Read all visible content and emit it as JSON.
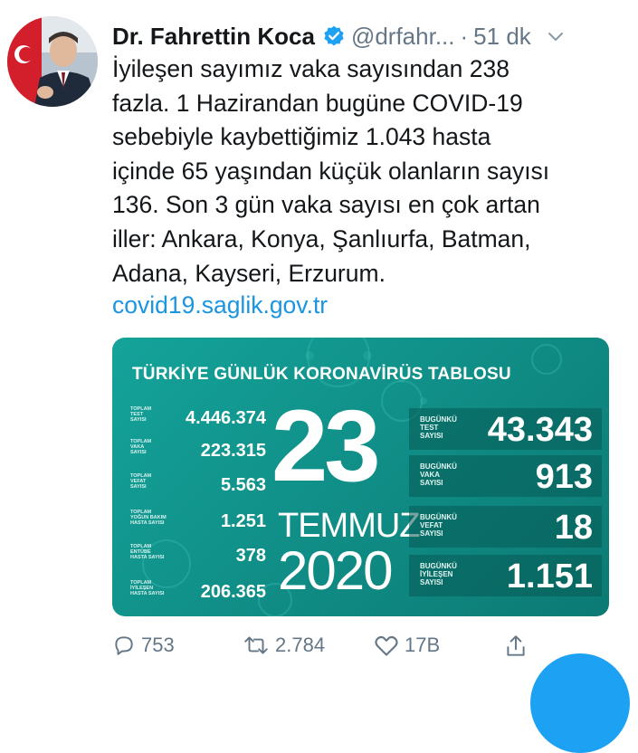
{
  "tweet": {
    "author_name": "Dr. Fahrettin Koca",
    "handle": "@drfahr...",
    "separator": "·",
    "time": "51 dk",
    "verified_icon": "verified-badge-icon",
    "body_lines": [
      "İyileşen sayımız vaka sayısından 238",
      "fazla. 1 Hazirandan bugüne COVID-19",
      "sebebiyle kaybettiğimiz 1.043 hasta",
      "içinde 65 yaşından küçük olanların sayısı",
      "136. Son 3 gün vaka sayısı en çok artan",
      "iller: Ankara, Konya, Şanlıurfa, Batman,",
      "Adana, Kayseri, Erzurum."
    ],
    "link": "covid19.saglik.gov.tr"
  },
  "card": {
    "title": "TÜRKİYE GÜNLÜK KORONAVİRÜS TABLOSU",
    "day": "23",
    "month": "TEMMUZ",
    "year": "2020",
    "background_color": "#14a39a",
    "totals": [
      {
        "label_lines": [
          "TOPLAM",
          "TEST",
          "SAYISI"
        ],
        "value": "4.446.374"
      },
      {
        "label_lines": [
          "TOPLAM",
          "VAKA",
          "SAYISI"
        ],
        "value": "223.315"
      },
      {
        "label_lines": [
          "TOPLAM",
          "VEFAT",
          "SAYISI"
        ],
        "value": "5.563"
      },
      {
        "label_lines": [
          "TOPLAM",
          "YOĞUN BAKIM",
          "HASTA SAYISI"
        ],
        "value": "1.251"
      },
      {
        "label_lines": [
          "TOPLAM",
          "ENTÜBE",
          "HASTA SAYISI"
        ],
        "value": "378"
      },
      {
        "label_lines": [
          "TOPLAM",
          "İYİLEŞEN",
          "HASTA SAYISI"
        ],
        "value": "206.365"
      }
    ],
    "today": [
      {
        "label_lines": [
          "BUGÜNKÜ",
          "TEST",
          "SAYISI"
        ],
        "value": "43.343"
      },
      {
        "label_lines": [
          "BUGÜNKÜ",
          "VAKA",
          "SAYISI"
        ],
        "value": "913"
      },
      {
        "label_lines": [
          "BUGÜNKÜ",
          "VEFAT",
          "SAYISI"
        ],
        "value": "18"
      },
      {
        "label_lines": [
          "BUGÜNKÜ",
          "İYİLEŞEN",
          "SAYISI"
        ],
        "value": "1.151"
      }
    ]
  },
  "actions": {
    "reply_count": "753",
    "retweet_count": "2.784",
    "like_count": "17B",
    "icons": [
      "reply-icon",
      "retweet-icon",
      "like-icon",
      "share-icon"
    ]
  },
  "colors": {
    "link": "#1b95e0",
    "secondary_text": "#657786",
    "verified": "#1da1f2",
    "fab": "#1da1f2"
  }
}
